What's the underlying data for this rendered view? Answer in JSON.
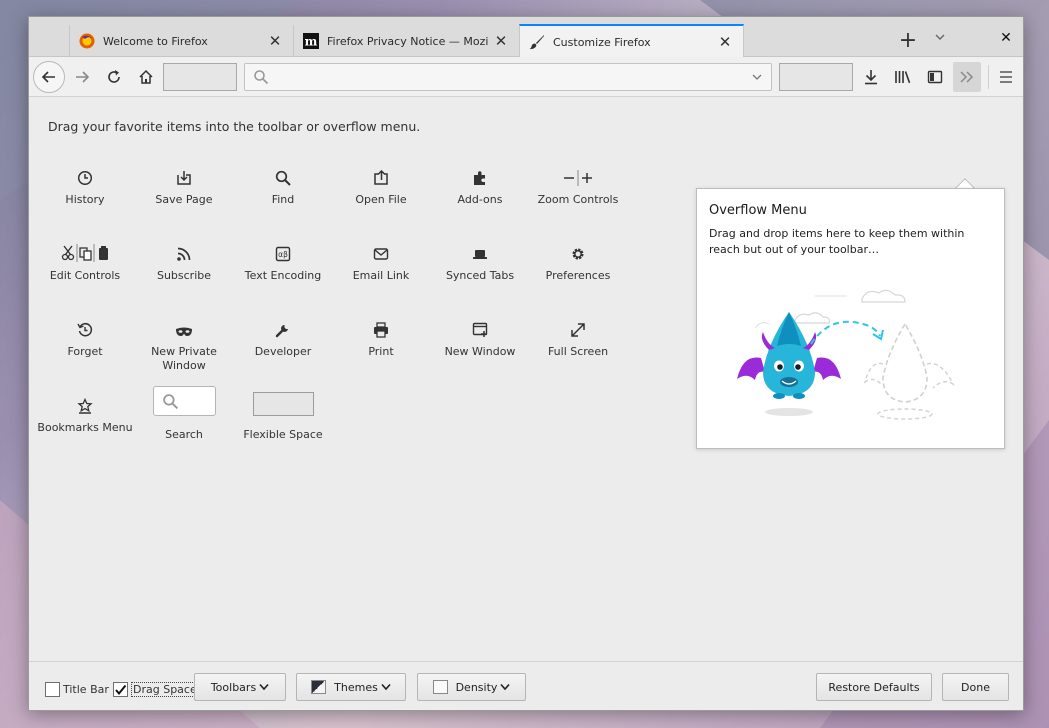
{
  "tabs": [
    {
      "title": "Welcome to Firefox",
      "icon": "firefox-logo-icon"
    },
    {
      "title": "Firefox Privacy Notice — Mozilla",
      "icon": "mozilla-m-icon"
    },
    {
      "title": "Customize Firefox",
      "icon": "paintbrush-icon"
    }
  ],
  "customize": {
    "instruction": "Drag your favorite items into the toolbar or overflow menu.",
    "items": [
      {
        "label": "History",
        "icon": "history-clock-icon"
      },
      {
        "label": "Save Page",
        "icon": "save-page-icon"
      },
      {
        "label": "Find",
        "icon": "find-magnifier-icon"
      },
      {
        "label": "Open File",
        "icon": "open-file-icon"
      },
      {
        "label": "Add-ons",
        "icon": "puzzle-piece-icon"
      },
      {
        "label": "Zoom Controls",
        "icon": "zoom-controls-icon"
      },
      {
        "label": "Edit Controls",
        "icon": "edit-controls-icon"
      },
      {
        "label": "Subscribe",
        "icon": "rss-feed-icon"
      },
      {
        "label": "Text Encoding",
        "icon": "text-encoding-icon"
      },
      {
        "label": "Email Link",
        "icon": "envelope-icon"
      },
      {
        "label": "Synced Tabs",
        "icon": "synced-tabs-icon"
      },
      {
        "label": "Preferences",
        "icon": "gear-icon"
      },
      {
        "label": "Forget",
        "icon": "forget-icon"
      },
      {
        "label": "New Private Window",
        "icon": "mask-icon"
      },
      {
        "label": "Developer",
        "icon": "wrench-icon"
      },
      {
        "label": "Print",
        "icon": "printer-icon"
      },
      {
        "label": "New Window",
        "icon": "new-window-icon"
      },
      {
        "label": "Full Screen",
        "icon": "expand-arrow-icon"
      },
      {
        "label": "Bookmarks Menu",
        "icon": "bookmarks-star-icon"
      },
      {
        "label": "Search",
        "icon": "search-box-icon"
      },
      {
        "label": "Flexible Space",
        "icon": "flexible-space-icon"
      }
    ]
  },
  "overflow_panel": {
    "title": "Overflow Menu",
    "description": "Drag and drop items here to keep them within reach but out of your toolbar…"
  },
  "footer": {
    "title_bar": {
      "label": "Title Bar",
      "checked": false
    },
    "drag_space": {
      "label": "Drag Space",
      "checked": true
    },
    "toolbars": "Toolbars",
    "themes": "Themes",
    "density": "Density",
    "restore_defaults": "Restore Defaults",
    "done": "Done"
  }
}
